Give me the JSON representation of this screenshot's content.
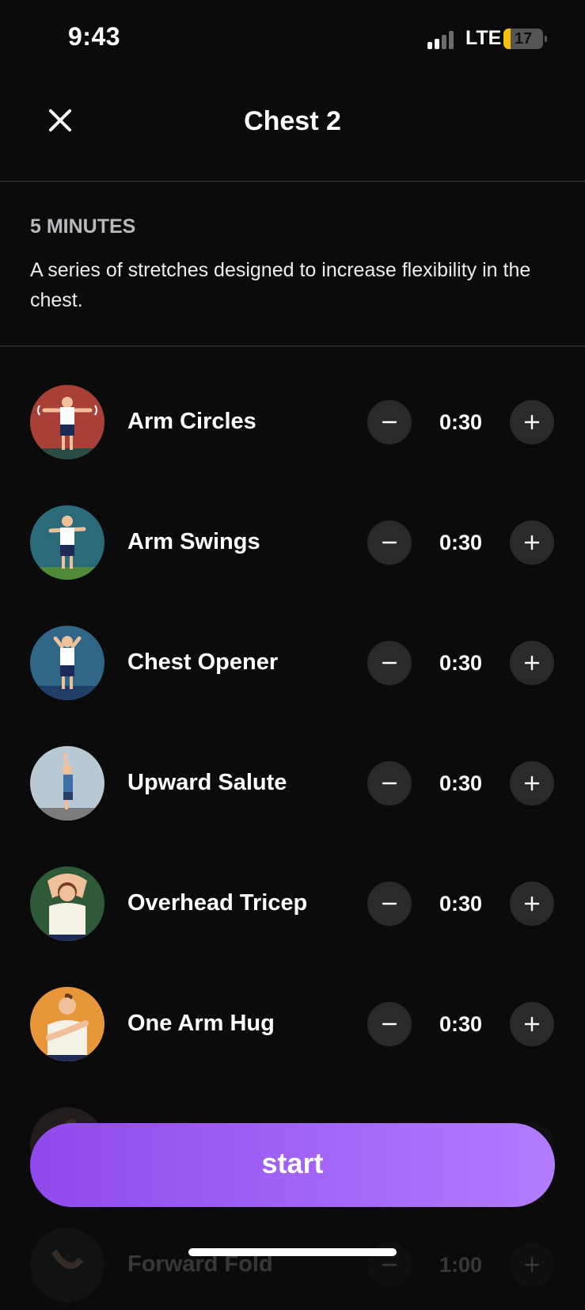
{
  "status_bar": {
    "time": "9:43",
    "network": "LTE",
    "battery_level": "17",
    "battery_fraction": 0.17,
    "signal_bars_active": 2,
    "signal_bars_total": 4
  },
  "header": {
    "title": "Chest 2",
    "close_icon": "close-icon"
  },
  "details": {
    "duration_label": "5 MINUTES",
    "description": "A series of stretches designed to increase flexibility in the chest."
  },
  "exercises": [
    {
      "name": "Arm Circles",
      "duration": "0:30",
      "thumb_color": "#a94038"
    },
    {
      "name": "Arm Swings",
      "duration": "0:30",
      "thumb_color": "#2b6a78"
    },
    {
      "name": "Chest Opener",
      "duration": "0:30",
      "thumb_color": "#2f6585"
    },
    {
      "name": "Upward Salute",
      "duration": "0:30",
      "thumb_color": "#b9c9d3"
    },
    {
      "name": "Overhead Tricep",
      "duration": "0:30",
      "thumb_color": "#2f5a37"
    },
    {
      "name": "One Arm Hug",
      "duration": "0:30",
      "thumb_color": "#e7973a"
    },
    {
      "name": "",
      "duration": "",
      "thumb_color": "#8a6f67"
    },
    {
      "name": "Forward Fold",
      "duration": "1:00",
      "thumb_color": "#2a3a2a"
    }
  ],
  "icons": {
    "minus": "minus-icon",
    "plus": "plus-icon"
  },
  "start_button": {
    "label": "start"
  },
  "colors": {
    "background": "#0b0b0c",
    "accent_start": "#9049ec",
    "accent_end": "#b27cff",
    "button_bg": "#2a2a2d",
    "battery": "#f4c20d"
  }
}
